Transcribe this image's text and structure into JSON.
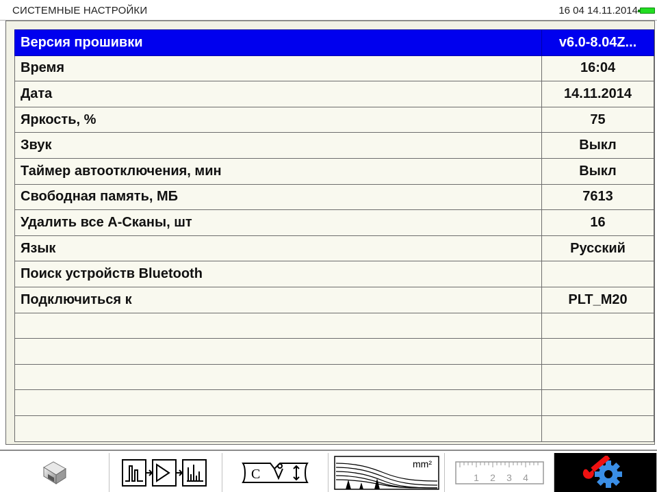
{
  "header": {
    "title": "СИСТЕМНЫЕ НАСТРОЙКИ",
    "datetime": "16 04 14.11.2014",
    "battery_color": "#22dd22"
  },
  "settings": [
    {
      "name": "Версия прошивки",
      "value": "v6.0-8.04Z...",
      "selected": true
    },
    {
      "name": "Время",
      "value": "16:04"
    },
    {
      "name": "Дата",
      "value": "14.11.2014"
    },
    {
      "name": "Яркость, %",
      "value": "75"
    },
    {
      "name": "Звук",
      "value": "Выкл"
    },
    {
      "name": "Таймер автоотключения, мин",
      "value": "Выкл"
    },
    {
      "name": "Свободная память, МБ",
      "value": "7613"
    },
    {
      "name": "Удалить все А-Сканы, шт",
      "value": "16"
    },
    {
      "name": "Язык",
      "value": "Русский"
    },
    {
      "name": "Поиск устройств Bluetooth",
      "value": ""
    },
    {
      "name": "Подключиться к",
      "value": "PLT_M20"
    }
  ],
  "empty_rows": 5,
  "toolbar": {
    "tabs": [
      {
        "icon": "device-icon"
      },
      {
        "icon": "signal-chain-icon"
      },
      {
        "icon": "weld-probe-icon"
      },
      {
        "icon": "area-mm2-icon",
        "label": "mm²"
      },
      {
        "icon": "ruler-icon",
        "label": "1 2 3 4"
      },
      {
        "icon": "settings-gear-icon",
        "active": true
      }
    ]
  },
  "colors": {
    "selected_row": "#0000ee",
    "row_bg": "#f9f9ef",
    "panel_bg": "#f2f2e6",
    "settings_icon_red": "#ee1111",
    "settings_icon_blue": "#3a8ee6"
  }
}
